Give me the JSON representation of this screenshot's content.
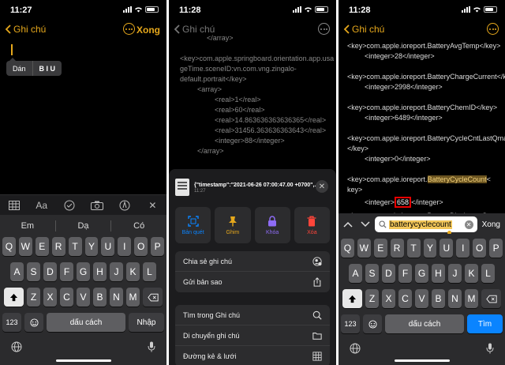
{
  "panel1": {
    "time": "11:27",
    "back_label": "Ghi chú",
    "done_label": "Xong",
    "edit_menu": {
      "paste": "Dán",
      "format": "B I U"
    },
    "toolbar_icons": [
      "table-icon",
      "text-format-icon",
      "checklist-icon",
      "camera-icon",
      "markup-icon",
      "close-icon"
    ],
    "suggestions": [
      "Em",
      "Dạ",
      "Có"
    ],
    "keys_row1": [
      "Q",
      "W",
      "E",
      "R",
      "T",
      "Y",
      "U",
      "I",
      "O",
      "P"
    ],
    "keys_row2": [
      "A",
      "S",
      "D",
      "F",
      "G",
      "H",
      "J",
      "K",
      "L"
    ],
    "keys_row3": [
      "Z",
      "X",
      "C",
      "V",
      "B",
      "N",
      "M"
    ],
    "num_label": "123",
    "space_label": "dấu cách",
    "return_label": "Nhập"
  },
  "panel2": {
    "time": "11:28",
    "back_label": "Ghi chú",
    "code_lines": [
      "</array>",
      "<key>com.apple.springboard.orientation.app.usa",
      "geTime.sceneID:vn.com.vng.zingalo-",
      "default.portrait</key>",
      "<array>",
      "<real>1</real>",
      "<real>60</real>",
      "<real>14.863636363636365</real>",
      "<real>31456.363636363643</real>",
      "<integer>88</integer>",
      "</array>"
    ],
    "sheet": {
      "title": "{\"timestamp\":\"2021-06-26 07:00:47.00 +0700\",...",
      "subtitle": "11:27",
      "actions": [
        {
          "label": "Bản quét",
          "icon": "scan-icon",
          "color": "#0a84ff"
        },
        {
          "label": "Ghim",
          "icon": "pin-icon",
          "color": "#e6a81c"
        },
        {
          "label": "Khóa",
          "icon": "lock-icon",
          "color": "#8e6cf5"
        },
        {
          "label": "Xóa",
          "icon": "trash-icon",
          "color": "#ff453a"
        }
      ],
      "group1": [
        {
          "label": "Chia sẻ ghi chú",
          "icon": "share-person-icon"
        },
        {
          "label": "Gửi bản sao",
          "icon": "share-icon"
        }
      ],
      "group2": [
        {
          "label": "Tìm trong Ghi chú",
          "icon": "search-icon"
        },
        {
          "label": "Di chuyển ghi chú",
          "icon": "folder-icon"
        },
        {
          "label": "Đường kẻ & lưới",
          "icon": "grid-icon"
        }
      ]
    }
  },
  "panel3": {
    "time": "11:28",
    "back_label": "Ghi chú",
    "code": {
      "l1": "<key>com.apple.ioreport.BatteryAvgTemp</key>",
      "l2": "<integer>28</integer>",
      "l3": "<key>com.apple.ioreport.BatteryChargeCurrent</key>",
      "l4": "<integer>2998</integer>",
      "l5": "<key>com.apple.ioreport.BatteryChemID</key>",
      "l6": "<integer>6489</integer>",
      "l7a": "<key>com.apple.ioreport.BatteryCycleCntLastQmax",
      "l7b": "</key>",
      "l8": "<integer>0</integer>",
      "l9_prefix": "<key>com.apple.ioreport.",
      "l9_hl": "BatteryCycleCount",
      "l9_suffix": "<",
      "l9b": "key>",
      "l10_prefix": "<integer>",
      "l10_value": "658",
      "l10_suffix": "</integer>",
      "l11": "<key>com.apple.ioreport.BatteryDischargeCurrent"
    },
    "search_value": "batterycyclecount",
    "find_done": "Xong",
    "keys_row1": [
      "Q",
      "W",
      "E",
      "R",
      "T",
      "Y",
      "U",
      "I",
      "O",
      "P"
    ],
    "keys_row2": [
      "A",
      "S",
      "D",
      "F",
      "G",
      "H",
      "J",
      "K",
      "L"
    ],
    "keys_row3": [
      "Z",
      "X",
      "C",
      "V",
      "B",
      "N",
      "M"
    ],
    "num_label": "123",
    "space_label": "dấu cách",
    "search_label": "Tìm"
  }
}
